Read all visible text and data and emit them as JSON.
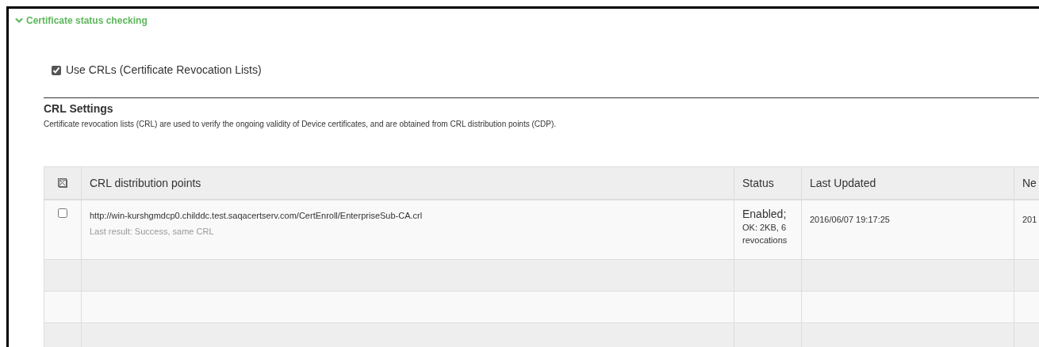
{
  "section": {
    "title": "Certificate status checking",
    "expanded": true
  },
  "use_crls": {
    "label": "Use CRLs (Certificate Revocation Lists)",
    "checked": true
  },
  "crl_settings": {
    "title": "CRL Settings",
    "description": "Certificate revocation lists (CRL) are used to verify the ongoing validity of Device certificates, and are obtained from CRL distribution points (CDP)."
  },
  "table": {
    "columns": [
      "CRL distribution points",
      "Status",
      "Last Updated",
      "Ne"
    ],
    "rows": [
      {
        "checked": false,
        "url": "http://win-kurshgmdcp0.childdc.test.saqacertserv.com/CertEnroll/EnterpriseSub-CA.crl",
        "last_result": "Last result: Success, same CRL",
        "status": "Enabled;",
        "status_detail": "OK: 2KB, 6 revocations",
        "last_updated": "2016/06/07 19:17:25",
        "next": "201"
      }
    ]
  }
}
